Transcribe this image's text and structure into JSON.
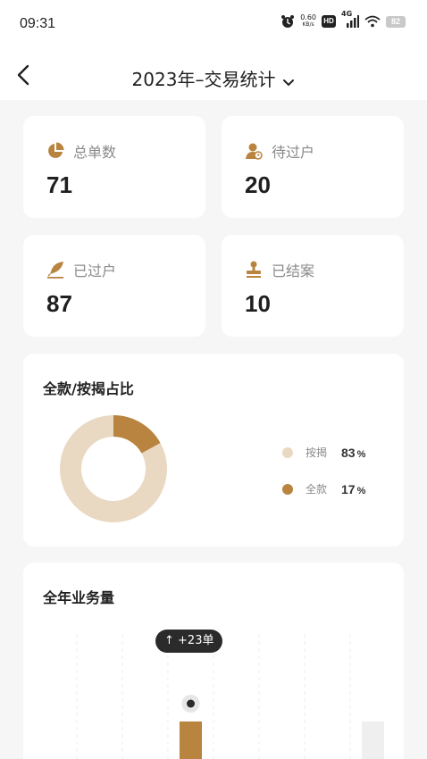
{
  "status_bar": {
    "time": "09:31",
    "net_speed_value": "0.60",
    "net_speed_unit": "KB/s",
    "hd_badge": "HD",
    "network_type": "4G",
    "battery": "82",
    "icons": [
      "alarm-icon",
      "hd-icon",
      "signal-icon",
      "wifi-icon",
      "battery-icon"
    ]
  },
  "header": {
    "title": "2023年–交易统计",
    "back_icon": "chevron-left-icon",
    "dropdown_icon": "chevron-down-icon"
  },
  "stats": [
    {
      "label": "总单数",
      "value": "71",
      "icon": "pie-chart-icon"
    },
    {
      "label": "待过户",
      "value": "20",
      "icon": "person-clock-icon"
    },
    {
      "label": "已过户",
      "value": "87",
      "icon": "quill-icon"
    },
    {
      "label": "已结案",
      "value": "10",
      "icon": "stamp-icon"
    }
  ],
  "ratio_section": {
    "title": "全款/按揭占比",
    "colors": {
      "mortgage": "#e9d8c2",
      "full": "#b8843f"
    },
    "legend": [
      {
        "name": "按揭",
        "percent": "83",
        "unit": "%"
      },
      {
        "name": "全款",
        "percent": "17",
        "unit": "%"
      }
    ]
  },
  "annual_section": {
    "title": "全年业务量",
    "tooltip": "↑ +23单"
  },
  "chart_data": [
    {
      "type": "pie",
      "title": "全款/按揭占比",
      "categories": [
        "按揭",
        "全款"
      ],
      "values": [
        83,
        17
      ],
      "legend_position": "right"
    },
    {
      "type": "bar",
      "title": "全年业务量",
      "series": [
        {
          "values": [
            0.2,
            0.07,
            0.62,
            0.08,
            0.62
          ],
          "highlight_index": 2
        }
      ],
      "categories": [],
      "annotation": "↑ +23单",
      "grid": "vertical-dashed"
    }
  ],
  "accent_color": "#b8843f"
}
